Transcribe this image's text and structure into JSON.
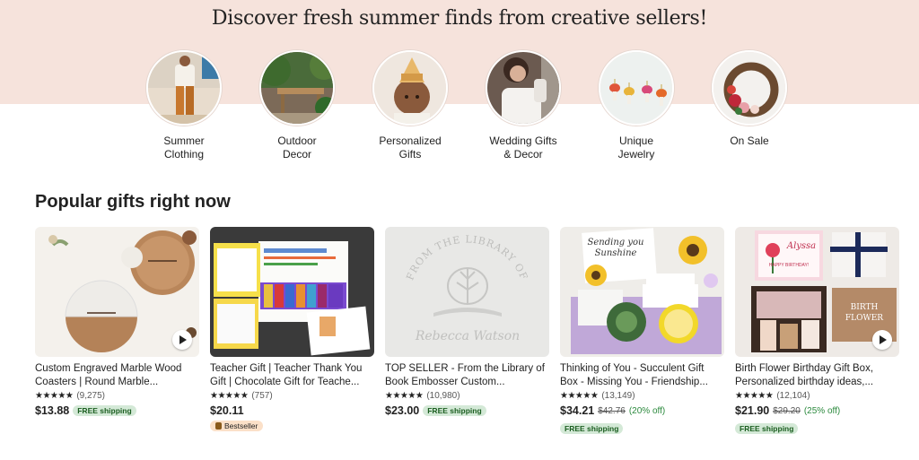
{
  "hero": {
    "title": "Discover fresh summer finds from creative sellers!"
  },
  "categories": [
    {
      "label": "Summer\nClothing",
      "icon": "summer-clothing-image"
    },
    {
      "label": "Outdoor\nDecor",
      "icon": "outdoor-decor-image"
    },
    {
      "label": "Personalized\nGifts",
      "icon": "personalized-gifts-image"
    },
    {
      "label": "Wedding Gifts\n& Decor",
      "icon": "wedding-gifts-image"
    },
    {
      "label": "Unique\nJewelry",
      "icon": "unique-jewelry-image"
    },
    {
      "label": "On Sale",
      "icon": "on-sale-image"
    }
  ],
  "section": {
    "title": "Popular gifts right now"
  },
  "products": [
    {
      "title": "Custom Engraved Marble Wood Coasters | Round Marble...",
      "stars": "★★★★★",
      "reviews": "(9,275)",
      "price": "$13.88",
      "shipping": "FREE shipping"
    },
    {
      "title": "Teacher Gift | Teacher Thank You Gift | Chocolate Gift for Teache...",
      "stars": "★★★★★",
      "reviews": "(757)",
      "price": "$20.11",
      "bestseller": "Bestseller"
    },
    {
      "title": "TOP SELLER - From the Library of Book Embosser Custom...",
      "stars": "★★★★★",
      "reviews": "(10,980)",
      "price": "$23.00",
      "shipping": "FREE shipping"
    },
    {
      "title": "Thinking of You - Succulent Gift Box - Missing You - Friendship...",
      "stars": "★★★★★",
      "reviews": "(13,149)",
      "price": "$34.21",
      "original_price": "$42.76",
      "discount": "(20% off)",
      "shipping": "FREE shipping"
    },
    {
      "title": "Birth Flower Birthday Gift Box, Personalized birthday ideas,...",
      "stars": "★★★★★",
      "reviews": "(12,104)",
      "price": "$21.90",
      "original_price": "$29.20",
      "discount": "(25% off)",
      "shipping": "FREE shipping"
    }
  ],
  "image_text": {
    "emboss_top": "FROM THE LIBRARY OF",
    "emboss_name": "Rebecca Watson",
    "sunshine": "Sending you\nSunshine",
    "card_name": "Alyssa",
    "card_happy": "HAPPY BIRTHDAY!",
    "birth_flower": "BIRTH\nFLOWER"
  },
  "colors": {
    "hero_bg": "#f6e3dc",
    "free_shipping_bg": "#d4e9d7",
    "bestseller_bg": "#fbe0c8",
    "discount": "#2c8a3e"
  }
}
